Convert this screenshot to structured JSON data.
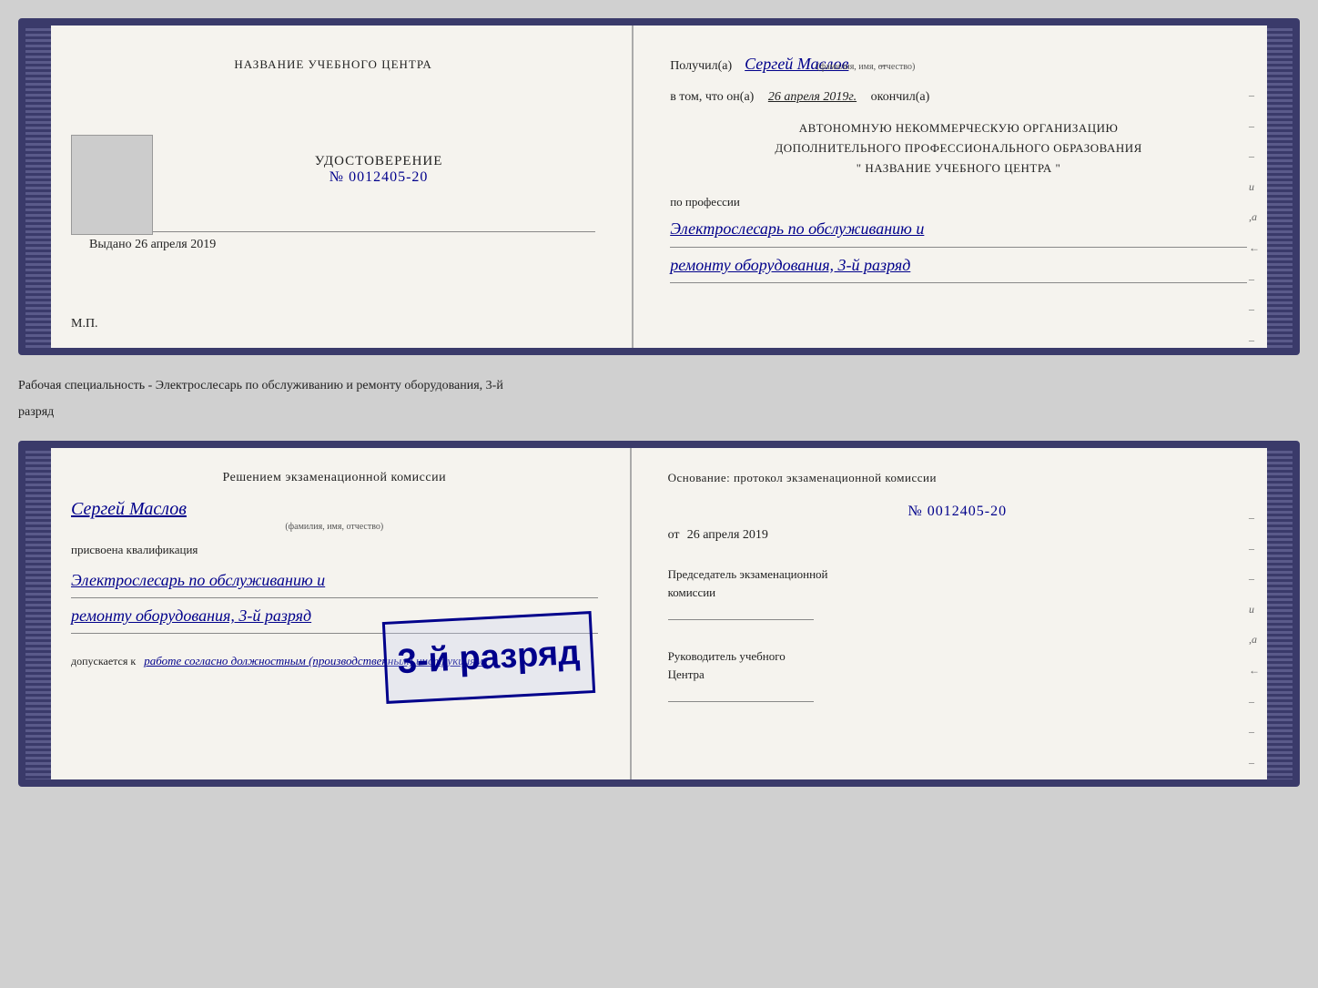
{
  "card1": {
    "left": {
      "center_title": "НАЗВАНИЕ УЧЕБНОГО ЦЕНТРА",
      "udostoverenie": "УДОСТОВЕРЕНИЕ",
      "number": "№ 0012405-20",
      "vydano_label": "Выдано",
      "vydano_date": "26 апреля 2019",
      "mp_label": "М.П."
    },
    "right": {
      "poluchil_label": "Получил(а)",
      "poluchil_name": "Сергей Маслов",
      "fio_label": "(фамилия, имя, отчество)",
      "v_tom_label": "в том, что он(а)",
      "v_tom_date": "26 апреля 2019г.",
      "okonchil_label": "окончил(а)",
      "org_line1": "АВТОНОМНУЮ НЕКОММЕРЧЕСКУЮ ОРГАНИЗАЦИЮ",
      "org_line2": "ДОПОЛНИТЕЛЬНОГО ПРОФЕССИОНАЛЬНОГО ОБРАЗОВАНИЯ",
      "org_line3": "\"  НАЗВАНИЕ УЧЕБНОГО ЦЕНТРА  \"",
      "po_professii_label": "по профессии",
      "profession_line1": "Электрослесарь по обслуживанию и",
      "profession_line2": "ремонту оборудования, 3-й разряд"
    }
  },
  "between_text": {
    "line1": "Рабочая специальность - Электрослесарь по обслуживанию и ремонту оборудования, 3-й",
    "line2": "разряд"
  },
  "card2": {
    "left": {
      "resheniem_title": "Решением экзаменационной комиссии",
      "name": "Сергей Маслов",
      "fio_label": "(фамилия, имя, отчество)",
      "prisvoyena_label": "присвоена квалификация",
      "qualification_line1": "Электрослесарь по обслуживанию и",
      "qualification_line2": "ремонту оборудования, 3-й разряд",
      "dopuskaetsya_prefix": "допускается к",
      "dopuskaetsya_text": "работе согласно должностным (производственным) инструкциям"
    },
    "right": {
      "osnovanie_title": "Основание: протокол экзаменационной комиссии",
      "number": "№  0012405-20",
      "ot_label": "от",
      "ot_date": "26 апреля 2019",
      "predsedatel_line1": "Председатель экзаменационной",
      "predsedatel_line2": "комиссии",
      "rukovoditel_line1": "Руководитель учебного",
      "rukovoditel_line2": "Центра"
    },
    "stamp": {
      "text": "3-й разряд"
    }
  }
}
